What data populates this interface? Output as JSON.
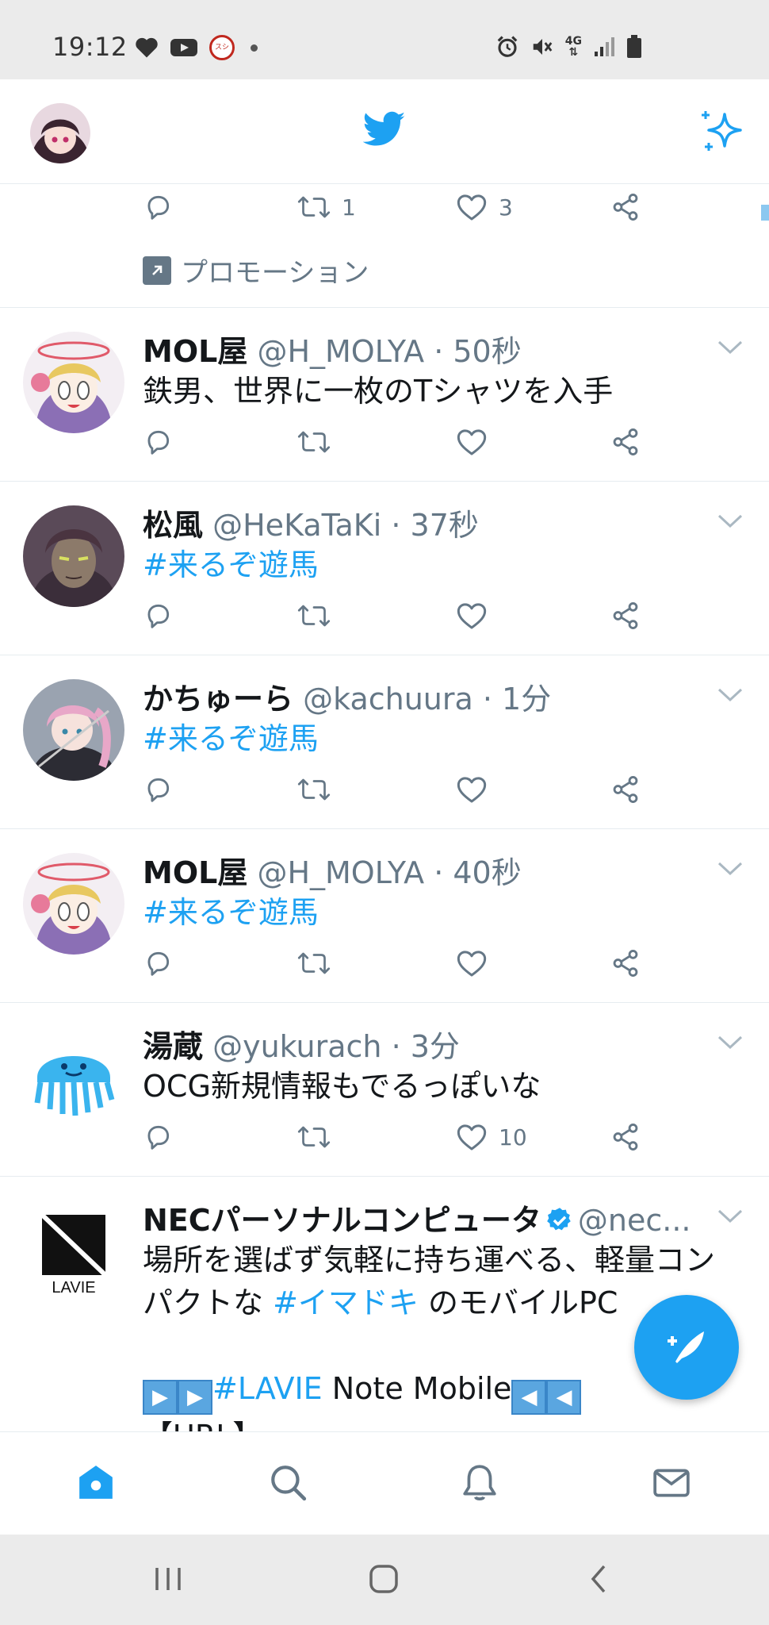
{
  "status_bar": {
    "time": "19:12",
    "app_badge": "スシロー",
    "network": "4G",
    "icons_left": [
      "heart-icon",
      "youtube-icon",
      "sushiro-app-icon",
      "dot-icon"
    ],
    "icons_right": [
      "alarm-icon",
      "mute-icon",
      "network-4g-icon",
      "signal-icon",
      "battery-icon"
    ]
  },
  "colors": {
    "accent": "#1da1f2",
    "text_primary": "#14171a",
    "text_secondary": "#657786",
    "divider": "#e6ecf0",
    "system_bar": "#ebebeb"
  },
  "promoted_tweet_partial": {
    "retweet_count": "1",
    "like_count": "3",
    "promotion_label": "プロモーション"
  },
  "tweets": [
    {
      "name": "MOL屋",
      "handle": "@H_MOLYA",
      "time": "· 50秒",
      "text": "鉄男、世界に一枚のTシャツを入手",
      "is_hashtag": false,
      "like_count": ""
    },
    {
      "name": "松風",
      "handle": "@HeKaTaKi",
      "time": "· 37秒",
      "text": "#来るぞ遊馬",
      "is_hashtag": true,
      "like_count": ""
    },
    {
      "name": "かちゅーら",
      "handle": "@kachuura",
      "time": "· 1分",
      "text": "#来るぞ遊馬",
      "is_hashtag": true,
      "like_count": ""
    },
    {
      "name": "MOL屋",
      "handle": "@H_MOLYA",
      "time": "· 40秒",
      "text": "#来るぞ遊馬",
      "is_hashtag": true,
      "like_count": ""
    },
    {
      "name": "湯蔵",
      "handle": "@yukurach",
      "time": "· 3分",
      "text": "OCG新規情報もでるっぽいな",
      "is_hashtag": false,
      "like_count": "10"
    }
  ],
  "ad_tweet": {
    "name": "NECパーソナルコンピュータ",
    "handle": "@nec...",
    "logo_text": "LAVIE",
    "line1": "場所を選ばず気軽に持ち運べる、軽量コン",
    "line2_prefix": "パクトな ",
    "line2_hashtag": "#イマドキ",
    "line2_suffix": " のモバイルPC",
    "line4_hashtag": "#LAVIE",
    "line4_suffix": " Note Mobile",
    "line5": "【URL】"
  },
  "bottom_nav": [
    "home-icon",
    "search-icon",
    "notifications-icon",
    "messages-icon"
  ],
  "android_nav": [
    "recent-apps-icon",
    "home-button-icon",
    "back-icon"
  ]
}
